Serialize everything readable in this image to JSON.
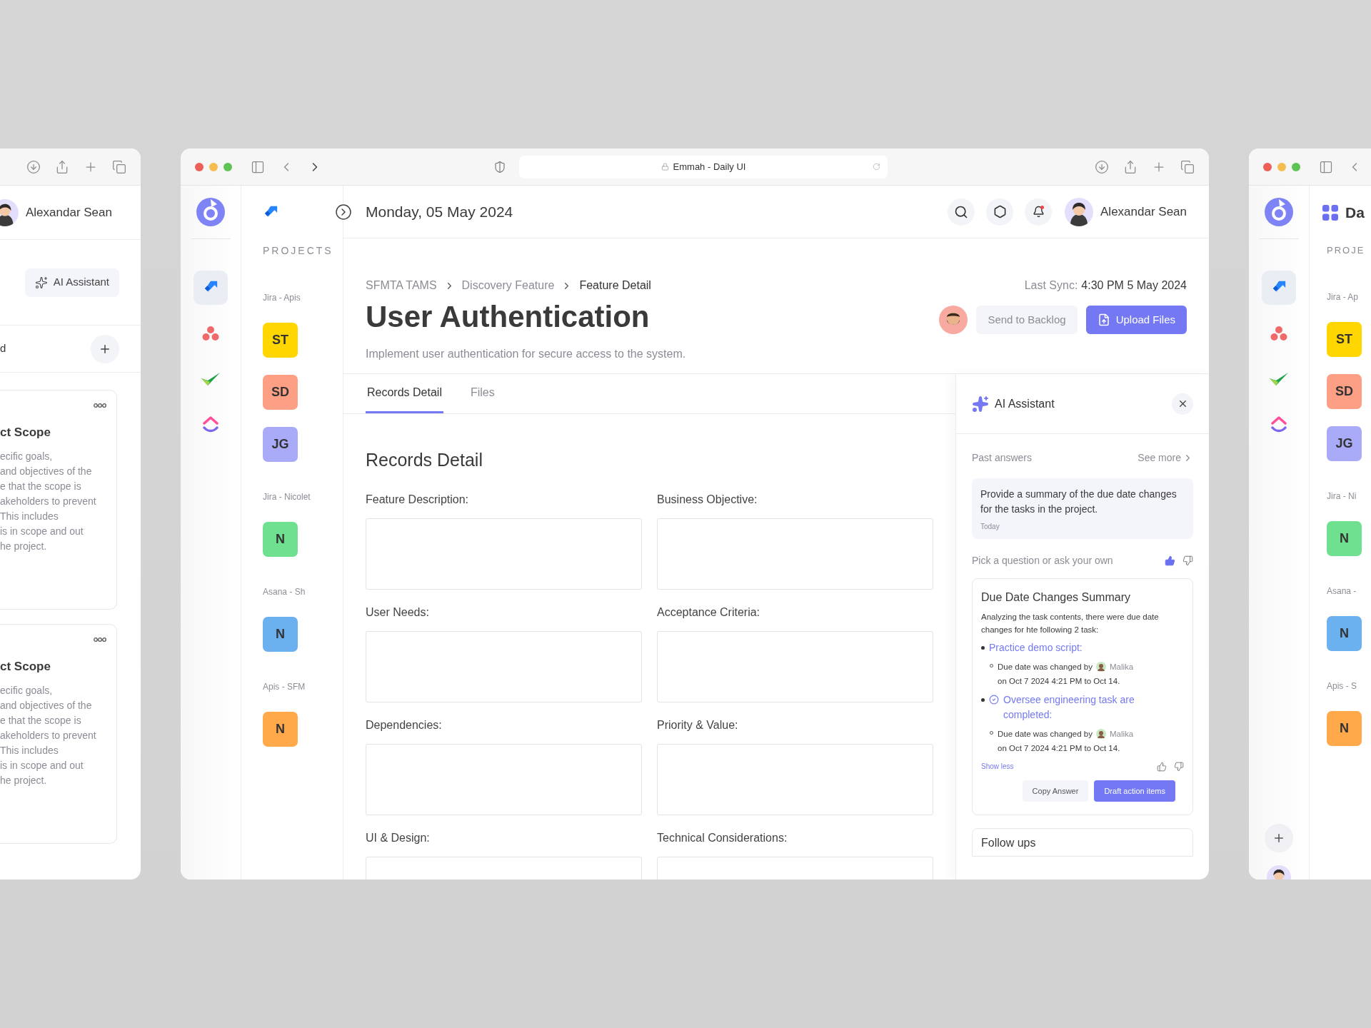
{
  "left_window": {
    "user_name": "Alexandar Sean",
    "ai_button": "AI Assistant",
    "list_label": "d",
    "cards": [
      {
        "title": "ct Scope",
        "lines": [
          "ecific goals,",
          "and objectives of the",
          "e that the scope is",
          "akeholders to prevent",
          "This includes",
          "is in scope and out",
          "he project."
        ]
      },
      {
        "title": "ct Scope",
        "lines": [
          "ecific goals,",
          "and objectives of the",
          "e that the scope is",
          "akeholders to prevent",
          "This includes",
          "is in scope and out",
          "he project."
        ]
      }
    ]
  },
  "center_window": {
    "address": "Emmah - Daily UI",
    "rail_apps": [
      {
        "kind": "jira",
        "selected": true
      },
      {
        "kind": "asana",
        "selected": false
      },
      {
        "kind": "check",
        "selected": false
      },
      {
        "kind": "clickup",
        "selected": false
      }
    ],
    "projects_heading": "PROJECTS",
    "project_groups": [
      {
        "label": "Jira - Apis",
        "projects": [
          {
            "initials": "ST",
            "color": "#ffd600"
          },
          {
            "initials": "SD",
            "color": "#fd9f85"
          },
          {
            "initials": "JG",
            "color": "#a9abf8"
          }
        ]
      },
      {
        "label": "Jira - Nicolet",
        "projects": [
          {
            "initials": "N",
            "color": "#6ee08f"
          }
        ]
      },
      {
        "label": "Asana - Sh",
        "projects": [
          {
            "initials": "N",
            "color": "#6cb1ef"
          }
        ]
      },
      {
        "label": "Apis - SFM",
        "projects": [
          {
            "initials": "N",
            "color": "#ffa94b"
          }
        ]
      }
    ],
    "date": "Monday, 05 May 2024",
    "notification_unread": true,
    "user_name": "Alexandar Sean",
    "breadcrumb": [
      "SFMTA TAMS",
      "Discovery Feature",
      "Feature Detail"
    ],
    "last_sync_label": "Last Sync:",
    "last_sync_value": "4:30 PM 5 May 2024",
    "title": "User Authentication",
    "description": "Implement user authentication for secure access to the system.",
    "secondary_button": "Send to Backlog",
    "primary_button": "Upload Files",
    "tabs": [
      {
        "label": "Records Detail",
        "selected": true
      },
      {
        "label": "Files",
        "selected": false
      }
    ],
    "section_title": "Records Detail",
    "fields": [
      "Feature Description:",
      "Business Objective:",
      "User Needs:",
      "Acceptance Criteria:",
      "Dependencies:",
      "Priority & Value:",
      "UI & Design:",
      "Technical Considerations:"
    ],
    "ai_panel": {
      "title": "AI Assistant",
      "past_label": "Past answers",
      "see_more": "See more",
      "past_question": "Provide a summary of the due date changes for the tasks in the project.",
      "past_time": "Today",
      "prompt": "Pick a question or ask your own",
      "prompt_liked": true,
      "answer": {
        "title": "Due Date Changes Summary",
        "intro": "Analyzing the task contents, there were due date changes for hte following 2 task:",
        "items": [
          {
            "title": "Practice demo script:",
            "completed": false,
            "change_text": "Due date was changed by",
            "user": "Malika",
            "change_detail": "on Oct 7 2024 4:21 PM to Oct 14."
          },
          {
            "title": "Oversee engineering task are completed:",
            "completed": true,
            "change_text": "Due date was changed by",
            "user": "Malika",
            "change_detail": "on Oct 7 2024 4:21 PM to Oct 14."
          }
        ],
        "show_less": "Show less",
        "liked": false,
        "copy_button": "Copy Answer",
        "draft_button": "Draft action items"
      },
      "follow_ups": "Follow ups"
    }
  },
  "right_window": {
    "header_partial": "Da",
    "projects_heading": "PROJE",
    "rail_apps": [
      {
        "kind": "jira",
        "selected": true
      },
      {
        "kind": "asana",
        "selected": false
      },
      {
        "kind": "check",
        "selected": false
      },
      {
        "kind": "clickup",
        "selected": false
      }
    ],
    "project_groups": [
      {
        "label": "Jira - Ap",
        "projects": [
          {
            "initials": "ST",
            "color": "#ffd600"
          },
          {
            "initials": "SD",
            "color": "#fd9f85"
          },
          {
            "initials": "JG",
            "color": "#a9abf8"
          }
        ]
      },
      {
        "label": "Jira - Ni",
        "projects": [
          {
            "initials": "N",
            "color": "#6ee08f"
          }
        ]
      },
      {
        "label": "Asana -",
        "projects": [
          {
            "initials": "N",
            "color": "#6cb1ef"
          }
        ]
      },
      {
        "label": "Apis - S",
        "projects": [
          {
            "initials": "N",
            "color": "#ffa94b"
          }
        ]
      }
    ]
  }
}
